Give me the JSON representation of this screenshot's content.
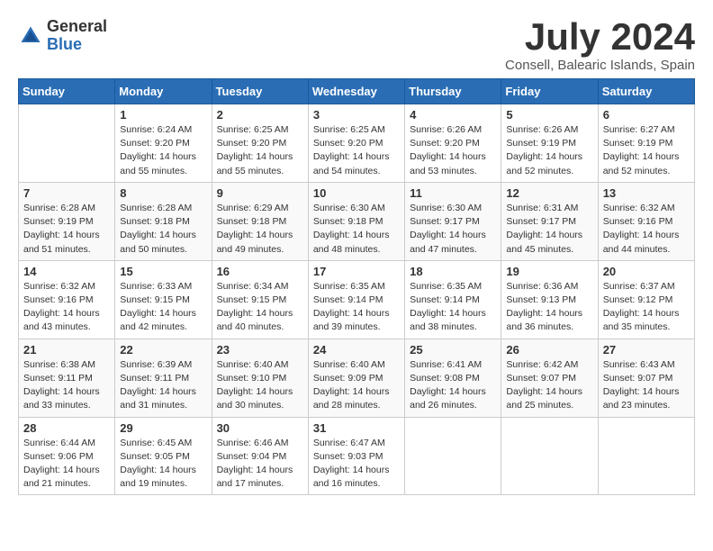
{
  "logo": {
    "general": "General",
    "blue": "Blue"
  },
  "header": {
    "month_year": "July 2024",
    "location": "Consell, Balearic Islands, Spain"
  },
  "days_of_week": [
    "Sunday",
    "Monday",
    "Tuesday",
    "Wednesday",
    "Thursday",
    "Friday",
    "Saturday"
  ],
  "weeks": [
    [
      {
        "day": "",
        "content": ""
      },
      {
        "day": "1",
        "content": "Sunrise: 6:24 AM\nSunset: 9:20 PM\nDaylight: 14 hours\nand 55 minutes."
      },
      {
        "day": "2",
        "content": "Sunrise: 6:25 AM\nSunset: 9:20 PM\nDaylight: 14 hours\nand 55 minutes."
      },
      {
        "day": "3",
        "content": "Sunrise: 6:25 AM\nSunset: 9:20 PM\nDaylight: 14 hours\nand 54 minutes."
      },
      {
        "day": "4",
        "content": "Sunrise: 6:26 AM\nSunset: 9:20 PM\nDaylight: 14 hours\nand 53 minutes."
      },
      {
        "day": "5",
        "content": "Sunrise: 6:26 AM\nSunset: 9:19 PM\nDaylight: 14 hours\nand 52 minutes."
      },
      {
        "day": "6",
        "content": "Sunrise: 6:27 AM\nSunset: 9:19 PM\nDaylight: 14 hours\nand 52 minutes."
      }
    ],
    [
      {
        "day": "7",
        "content": "Sunrise: 6:28 AM\nSunset: 9:19 PM\nDaylight: 14 hours\nand 51 minutes."
      },
      {
        "day": "8",
        "content": "Sunrise: 6:28 AM\nSunset: 9:18 PM\nDaylight: 14 hours\nand 50 minutes."
      },
      {
        "day": "9",
        "content": "Sunrise: 6:29 AM\nSunset: 9:18 PM\nDaylight: 14 hours\nand 49 minutes."
      },
      {
        "day": "10",
        "content": "Sunrise: 6:30 AM\nSunset: 9:18 PM\nDaylight: 14 hours\nand 48 minutes."
      },
      {
        "day": "11",
        "content": "Sunrise: 6:30 AM\nSunset: 9:17 PM\nDaylight: 14 hours\nand 47 minutes."
      },
      {
        "day": "12",
        "content": "Sunrise: 6:31 AM\nSunset: 9:17 PM\nDaylight: 14 hours\nand 45 minutes."
      },
      {
        "day": "13",
        "content": "Sunrise: 6:32 AM\nSunset: 9:16 PM\nDaylight: 14 hours\nand 44 minutes."
      }
    ],
    [
      {
        "day": "14",
        "content": "Sunrise: 6:32 AM\nSunset: 9:16 PM\nDaylight: 14 hours\nand 43 minutes."
      },
      {
        "day": "15",
        "content": "Sunrise: 6:33 AM\nSunset: 9:15 PM\nDaylight: 14 hours\nand 42 minutes."
      },
      {
        "day": "16",
        "content": "Sunrise: 6:34 AM\nSunset: 9:15 PM\nDaylight: 14 hours\nand 40 minutes."
      },
      {
        "day": "17",
        "content": "Sunrise: 6:35 AM\nSunset: 9:14 PM\nDaylight: 14 hours\nand 39 minutes."
      },
      {
        "day": "18",
        "content": "Sunrise: 6:35 AM\nSunset: 9:14 PM\nDaylight: 14 hours\nand 38 minutes."
      },
      {
        "day": "19",
        "content": "Sunrise: 6:36 AM\nSunset: 9:13 PM\nDaylight: 14 hours\nand 36 minutes."
      },
      {
        "day": "20",
        "content": "Sunrise: 6:37 AM\nSunset: 9:12 PM\nDaylight: 14 hours\nand 35 minutes."
      }
    ],
    [
      {
        "day": "21",
        "content": "Sunrise: 6:38 AM\nSunset: 9:11 PM\nDaylight: 14 hours\nand 33 minutes."
      },
      {
        "day": "22",
        "content": "Sunrise: 6:39 AM\nSunset: 9:11 PM\nDaylight: 14 hours\nand 31 minutes."
      },
      {
        "day": "23",
        "content": "Sunrise: 6:40 AM\nSunset: 9:10 PM\nDaylight: 14 hours\nand 30 minutes."
      },
      {
        "day": "24",
        "content": "Sunrise: 6:40 AM\nSunset: 9:09 PM\nDaylight: 14 hours\nand 28 minutes."
      },
      {
        "day": "25",
        "content": "Sunrise: 6:41 AM\nSunset: 9:08 PM\nDaylight: 14 hours\nand 26 minutes."
      },
      {
        "day": "26",
        "content": "Sunrise: 6:42 AM\nSunset: 9:07 PM\nDaylight: 14 hours\nand 25 minutes."
      },
      {
        "day": "27",
        "content": "Sunrise: 6:43 AM\nSunset: 9:07 PM\nDaylight: 14 hours\nand 23 minutes."
      }
    ],
    [
      {
        "day": "28",
        "content": "Sunrise: 6:44 AM\nSunset: 9:06 PM\nDaylight: 14 hours\nand 21 minutes."
      },
      {
        "day": "29",
        "content": "Sunrise: 6:45 AM\nSunset: 9:05 PM\nDaylight: 14 hours\nand 19 minutes."
      },
      {
        "day": "30",
        "content": "Sunrise: 6:46 AM\nSunset: 9:04 PM\nDaylight: 14 hours\nand 17 minutes."
      },
      {
        "day": "31",
        "content": "Sunrise: 6:47 AM\nSunset: 9:03 PM\nDaylight: 14 hours\nand 16 minutes."
      },
      {
        "day": "",
        "content": ""
      },
      {
        "day": "",
        "content": ""
      },
      {
        "day": "",
        "content": ""
      }
    ]
  ]
}
